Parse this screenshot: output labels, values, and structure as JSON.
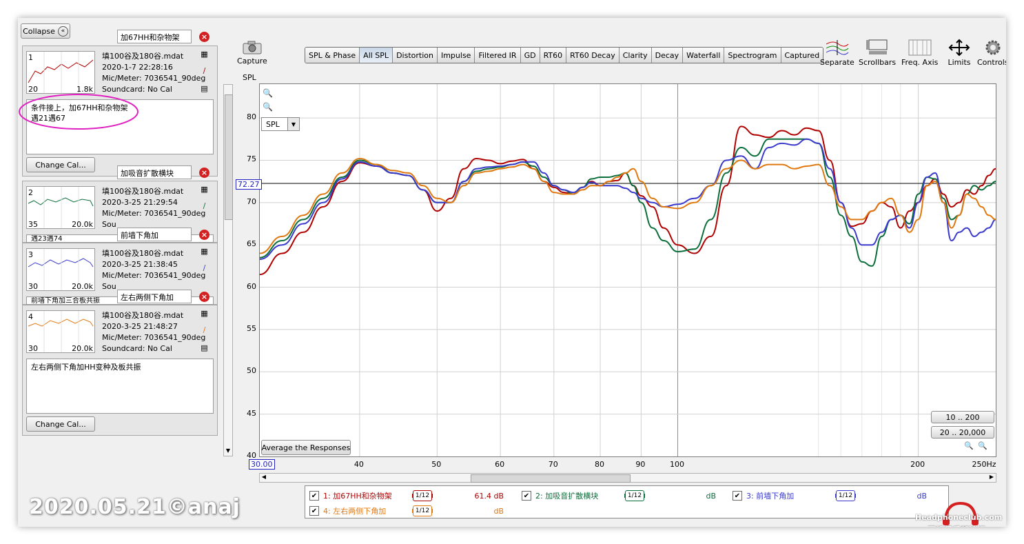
{
  "left_panel": {
    "collapse_label": "Collapse",
    "change_cal_label": "Change Cal...",
    "measurements": [
      {
        "index": "1",
        "title": "加67HH和杂物架",
        "file": "填100谷及180谷.mdat",
        "date": "2020-1-7 22:28:16",
        "mic": "Mic/Meter: 7036541_90deg",
        "soundcard": "Soundcard: No Cal",
        "notes_line1": "条件接上，加67HH和杂物架",
        "notes_line2": "遇21遇67",
        "thumb_min": "20",
        "thumb_max": "1.8k",
        "color": "#b00000"
      },
      {
        "index": "2",
        "title": "加吸音扩散横块",
        "file": "填100谷及180谷.mdat",
        "date": "2020-3-25 21:29:54",
        "mic": "Mic/Meter: 7036541_90deg",
        "soundcard": "Sou",
        "notes_line1": "遇23遇74",
        "thumb_min": "35",
        "thumb_max": "20.0k",
        "color": "#0a6e3a"
      },
      {
        "index": "3",
        "title": "前墙下角加",
        "file": "填100谷及180谷.mdat",
        "date": "2020-3-25 21:38:45",
        "mic": "Mic/Meter: 7036541_90deg",
        "soundcard": "Sou",
        "notes_line1": "前墙下角加三合板共振",
        "thumb_min": "30",
        "thumb_max": "20.0k",
        "color": "#3a3acc"
      },
      {
        "index": "4",
        "title": "左右两侧下角加",
        "file": "填100谷及180谷.mdat",
        "date": "2020-3-25 21:48:27",
        "mic": "Mic/Meter: 7036541_90deg",
        "soundcard": "Soundcard: No Cal",
        "notes_line1": "左右两侧下角加HH变种及板共振",
        "thumb_min": "30",
        "thumb_max": "20.0k",
        "color": "#e07810"
      }
    ]
  },
  "toolbar": {
    "capture_label": "Capture",
    "tabs": [
      "SPL & Phase",
      "All SPL",
      "Distortion",
      "Impulse",
      "Filtered IR",
      "GD",
      "RT60",
      "RT60 Decay",
      "Clarity",
      "Decay",
      "Waterfall",
      "Spectrogram",
      "Captured"
    ],
    "active_tab": "All SPL",
    "right_buttons": [
      {
        "label": "Separate",
        "icon": "separate-icon"
      },
      {
        "label": "Scrollbars",
        "icon": "scrollbars-icon"
      },
      {
        "label": "Freq. Axis",
        "icon": "freq-axis-icon"
      },
      {
        "label": "Limits",
        "icon": "limits-icon"
      },
      {
        "label": "Controls",
        "icon": "gear-icon"
      }
    ]
  },
  "chart_data": {
    "type": "line",
    "title": "",
    "ylabel": "SPL",
    "xlabel": "Hz",
    "x_scale": "log",
    "xlim": [
      30,
      250
    ],
    "ylim": [
      40,
      84
    ],
    "y_ticks": [
      "80",
      "75",
      "70",
      "65",
      "60",
      "55",
      "50",
      "45",
      "40"
    ],
    "x_ticks": [
      "40",
      "50",
      "60",
      "70",
      "80",
      "90",
      "100",
      "200",
      "250Hz"
    ],
    "x_start_label": "30.00",
    "cursor_value": "72.27",
    "spl_selector": "SPL",
    "average_button": "Average the Responses",
    "range_buttons": [
      "10 .. 200",
      "20 .. 20,000"
    ],
    "x": [
      30,
      32,
      34,
      36,
      38,
      40,
      42,
      44,
      46,
      48,
      50,
      52,
      54,
      56,
      58,
      60,
      62,
      64,
      66,
      68,
      70,
      72,
      74,
      76,
      78,
      80,
      82,
      84,
      86,
      88,
      90,
      93,
      96,
      100,
      105,
      110,
      115,
      120,
      125,
      130,
      135,
      140,
      145,
      150,
      155,
      160,
      165,
      170,
      175,
      180,
      185,
      190,
      195,
      200,
      205,
      210,
      215,
      220,
      225,
      230,
      235,
      240,
      245,
      250
    ],
    "series": [
      {
        "name": "1: 加67HH和杂物架",
        "color": "#b00000",
        "values": [
          61.5,
          64.0,
          66.5,
          69.5,
          72.5,
          74.7,
          74.3,
          73.5,
          73.2,
          71.5,
          69.0,
          70.5,
          74.0,
          75.2,
          75.0,
          74.6,
          74.9,
          75.1,
          74.0,
          72.5,
          71.8,
          71.2,
          71.0,
          71.8,
          72.5,
          72.0,
          72.5,
          72.6,
          73.5,
          72.0,
          70.8,
          69.5,
          67.0,
          65.0,
          64.0,
          66.0,
          72.0,
          79.0,
          78.0,
          77.7,
          78.5,
          78.0,
          78.8,
          78.5,
          75.0,
          70.0,
          67.2,
          67.5,
          69.0,
          70.0,
          69.5,
          67.0,
          69.0,
          70.0,
          72.0,
          72.8,
          71.0,
          69.5,
          70.0,
          71.5,
          71.0,
          72.0,
          73.2,
          74.0
        ]
      },
      {
        "name": "2: 加吸音扩散横块",
        "color": "#0a6e3a",
        "values": [
          63.5,
          65.5,
          68.0,
          70.5,
          73.0,
          75.0,
          74.5,
          73.5,
          73.2,
          71.5,
          70.0,
          70.0,
          72.5,
          73.7,
          74.0,
          74.2,
          74.5,
          74.8,
          74.3,
          73.0,
          72.0,
          71.5,
          71.0,
          71.8,
          72.8,
          73.0,
          73.0,
          73.2,
          73.5,
          72.0,
          70.0,
          67.0,
          65.5,
          64.2,
          64.5,
          68.0,
          73.5,
          76.5,
          75.5,
          77.5,
          77.5,
          77.5,
          77.5,
          77.0,
          73.0,
          68.5,
          66.0,
          63.0,
          62.5,
          66.0,
          68.0,
          68.5,
          67.5,
          71.0,
          73.0,
          72.8,
          70.5,
          68.0,
          68.5,
          71.0,
          72.0,
          71.5,
          72.0,
          72.5
        ]
      },
      {
        "name": "3: 前墙下角加",
        "color": "#3a3acc",
        "values": [
          63.3,
          65.0,
          67.5,
          70.0,
          72.8,
          74.8,
          74.3,
          73.5,
          73.2,
          71.5,
          70.0,
          70.0,
          72.5,
          74.0,
          74.2,
          74.3,
          74.5,
          74.8,
          74.8,
          73.5,
          72.0,
          71.5,
          71.2,
          71.8,
          72.4,
          72.0,
          72.0,
          72.0,
          71.7,
          71.2,
          70.5,
          70.0,
          69.5,
          69.8,
          70.5,
          72.0,
          75.0,
          75.5,
          74.0,
          76.5,
          77.0,
          76.8,
          77.5,
          77.0,
          74.0,
          70.0,
          67.0,
          65.0,
          65.0,
          66.5,
          68.0,
          68.5,
          67.0,
          70.0,
          73.0,
          73.5,
          70.0,
          65.5,
          66.5,
          67.0,
          66.0,
          66.5,
          67.0,
          68.0
        ]
      },
      {
        "name": "4: 左右两侧下角加",
        "color": "#e07810",
        "values": [
          64.0,
          66.0,
          68.5,
          71.0,
          73.5,
          75.2,
          74.5,
          73.8,
          73.5,
          72.0,
          70.5,
          70.0,
          72.0,
          73.5,
          73.7,
          74.0,
          74.2,
          74.5,
          74.0,
          72.5,
          71.2,
          71.0,
          71.0,
          71.5,
          72.0,
          72.0,
          72.5,
          73.0,
          73.5,
          74.0,
          72.5,
          70.5,
          69.5,
          69.3,
          70.0,
          72.0,
          74.0,
          75.0,
          74.0,
          74.5,
          74.5,
          74.0,
          74.3,
          74.5,
          72.0,
          69.5,
          68.0,
          68.0,
          69.0,
          70.0,
          70.5,
          68.5,
          66.5,
          68.0,
          72.0,
          72.5,
          70.0,
          67.0,
          68.5,
          71.0,
          70.5,
          69.5,
          68.5,
          68.0
        ]
      }
    ]
  },
  "legend": [
    {
      "label": "1: 加67HH和杂物架",
      "smoothing": "1/12",
      "value": "61.4 dB",
      "color": "#b00000"
    },
    {
      "label": "2: 加吸音扩散横块",
      "smoothing": "1/12",
      "value": "dB",
      "color": "#0a6e3a"
    },
    {
      "label": "3: 前墙下角加",
      "smoothing": "1/12",
      "value": "dB",
      "color": "#3a3acc"
    },
    {
      "label": "4: 左右两侧下角加",
      "smoothing": "1/12",
      "value": "dB",
      "color": "#e07810"
    }
  ],
  "watermark": "2020.05.21©anaj",
  "site_mark_top": "Headphoneclub.com",
  "site_mark_bottom": "耳机俱乐部论坛",
  "colors": {
    "annotation_ellipse": "#e020c0",
    "accent": "#c9d7e8"
  }
}
